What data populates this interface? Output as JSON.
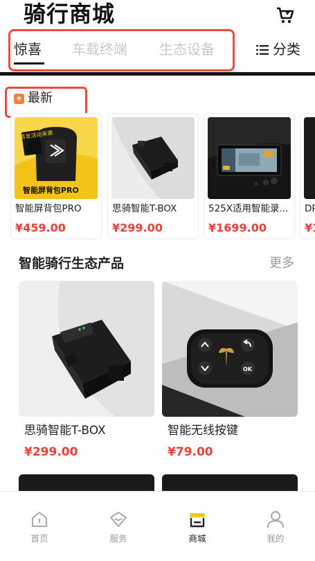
{
  "header": {
    "title": "骑行商城",
    "cart_icon": "cart-icon"
  },
  "tabs": [
    {
      "label": "惊喜",
      "active": true
    },
    {
      "label": "车载终端",
      "active": false
    },
    {
      "label": "生态设备",
      "active": false
    }
  ],
  "category": {
    "label": "分类",
    "icon": "menu-list-icon"
  },
  "newest": {
    "label": "最新",
    "badge_icon": "star-badge-icon",
    "items": [
      {
        "name": "智能屏背包PRO",
        "price": "¥459.00",
        "image_text": [
          "首发活动来袭",
          "智能屏背包PRO"
        ]
      },
      {
        "name": "思骑智能T-BOX",
        "price": "¥299.00"
      },
      {
        "name": "525X适用智能录...",
        "price": "¥1699.00"
      },
      {
        "name": "DR",
        "price": "¥1"
      }
    ]
  },
  "section": {
    "title": "智能骑行生态产品",
    "more": "更多",
    "products": [
      {
        "name": "思骑智能T-BOX",
        "price": "¥299.00"
      },
      {
        "name": "智能无线按键",
        "price": "¥79.00"
      }
    ]
  },
  "bottom_nav": [
    {
      "label": "首页",
      "icon": "home-icon",
      "active": false
    },
    {
      "label": "服务",
      "icon": "service-icon",
      "active": false
    },
    {
      "label": "商城",
      "icon": "shop-icon",
      "active": true
    },
    {
      "label": "我的",
      "icon": "user-icon",
      "active": false
    }
  ],
  "colors": {
    "accent_red": "#e8413a",
    "highlight_red": "#e94b3c",
    "shop_yellow": "#f5c518",
    "badge_orange": "#f0833a"
  }
}
